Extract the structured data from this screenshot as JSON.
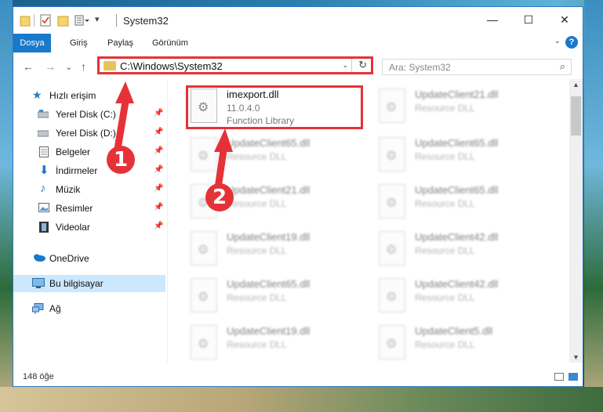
{
  "colors": {
    "accent": "#1979ca",
    "highlight": "#e53238",
    "selected": "#cce8ff"
  },
  "window": {
    "title": "System32",
    "quick_access_icons": [
      "folder-icon",
      "properties-icon",
      "new-folder-icon",
      "customize-icon"
    ],
    "controls": {
      "minimize": "—",
      "maximize": "☐",
      "close": "✕"
    }
  },
  "ribbon": {
    "tabs": [
      "Dosya",
      "Giriş",
      "Paylaş",
      "Görünüm"
    ],
    "expand_glyph": "⌄",
    "help_glyph": "?"
  },
  "address": {
    "back": "←",
    "forward": "→",
    "recent": "⌄",
    "up": "↑",
    "path": "C:\\Windows\\System32",
    "dropdown": "⌄",
    "refresh": "↻"
  },
  "search": {
    "placeholder": "Ara: System32",
    "icon": "⌕"
  },
  "sidebar": {
    "items": [
      {
        "label": "Hızlı erişim",
        "icon": "star-icon",
        "pinned": false
      },
      {
        "label": "Yerel Disk (C:)",
        "icon": "drive-icon",
        "pinned": true
      },
      {
        "label": "Yerel Disk (D:)",
        "icon": "drive-icon",
        "pinned": true
      },
      {
        "label": "Belgeler",
        "icon": "documents-icon",
        "pinned": true
      },
      {
        "label": "İndirmeler",
        "icon": "downloads-icon",
        "pinned": true
      },
      {
        "label": "Müzik",
        "icon": "music-icon",
        "pinned": true
      },
      {
        "label": "Resimler",
        "icon": "pictures-icon",
        "pinned": true
      },
      {
        "label": "Videolar",
        "icon": "videos-icon",
        "pinned": true
      },
      {
        "label": "OneDrive",
        "icon": "onedrive-icon",
        "pinned": false
      },
      {
        "label": "Bu bilgisayar",
        "icon": "computer-icon",
        "pinned": false,
        "selected": true
      },
      {
        "label": "Ağ",
        "icon": "network-icon",
        "pinned": false
      }
    ],
    "pin_glyph": "📌"
  },
  "files": [
    {
      "name": "imexport.dll",
      "line1": "11.0.4.0",
      "line2": "Function Library",
      "highlighted": true
    },
    {
      "name": "UpdateClient21.dll",
      "line1": "Resource DLL"
    },
    {
      "name": "UpdateClient65.dll",
      "line1": "Resource DLL"
    },
    {
      "name": "UpdateClient65.dll",
      "line1": "Resource DLL"
    },
    {
      "name": "UpdateClient21.dll",
      "line1": "Resource DLL"
    },
    {
      "name": "UpdateClient65.dll",
      "line1": "Resource DLL"
    },
    {
      "name": "UpdateClient19.dll",
      "line1": "Resource DLL"
    },
    {
      "name": "UpdateClient42.dll",
      "line1": "Resource DLL"
    },
    {
      "name": "UpdateClient65.dll",
      "line1": "Resource DLL"
    },
    {
      "name": "UpdateClient42.dll",
      "line1": "Resource DLL"
    },
    {
      "name": "UpdateClient19.dll",
      "line1": "Resource DLL"
    },
    {
      "name": "UpdateClient5.dll",
      "line1": "Resource DLL"
    }
  ],
  "status": {
    "count": "148 öğe"
  },
  "annotations": {
    "step1": "1",
    "step2": "2"
  }
}
